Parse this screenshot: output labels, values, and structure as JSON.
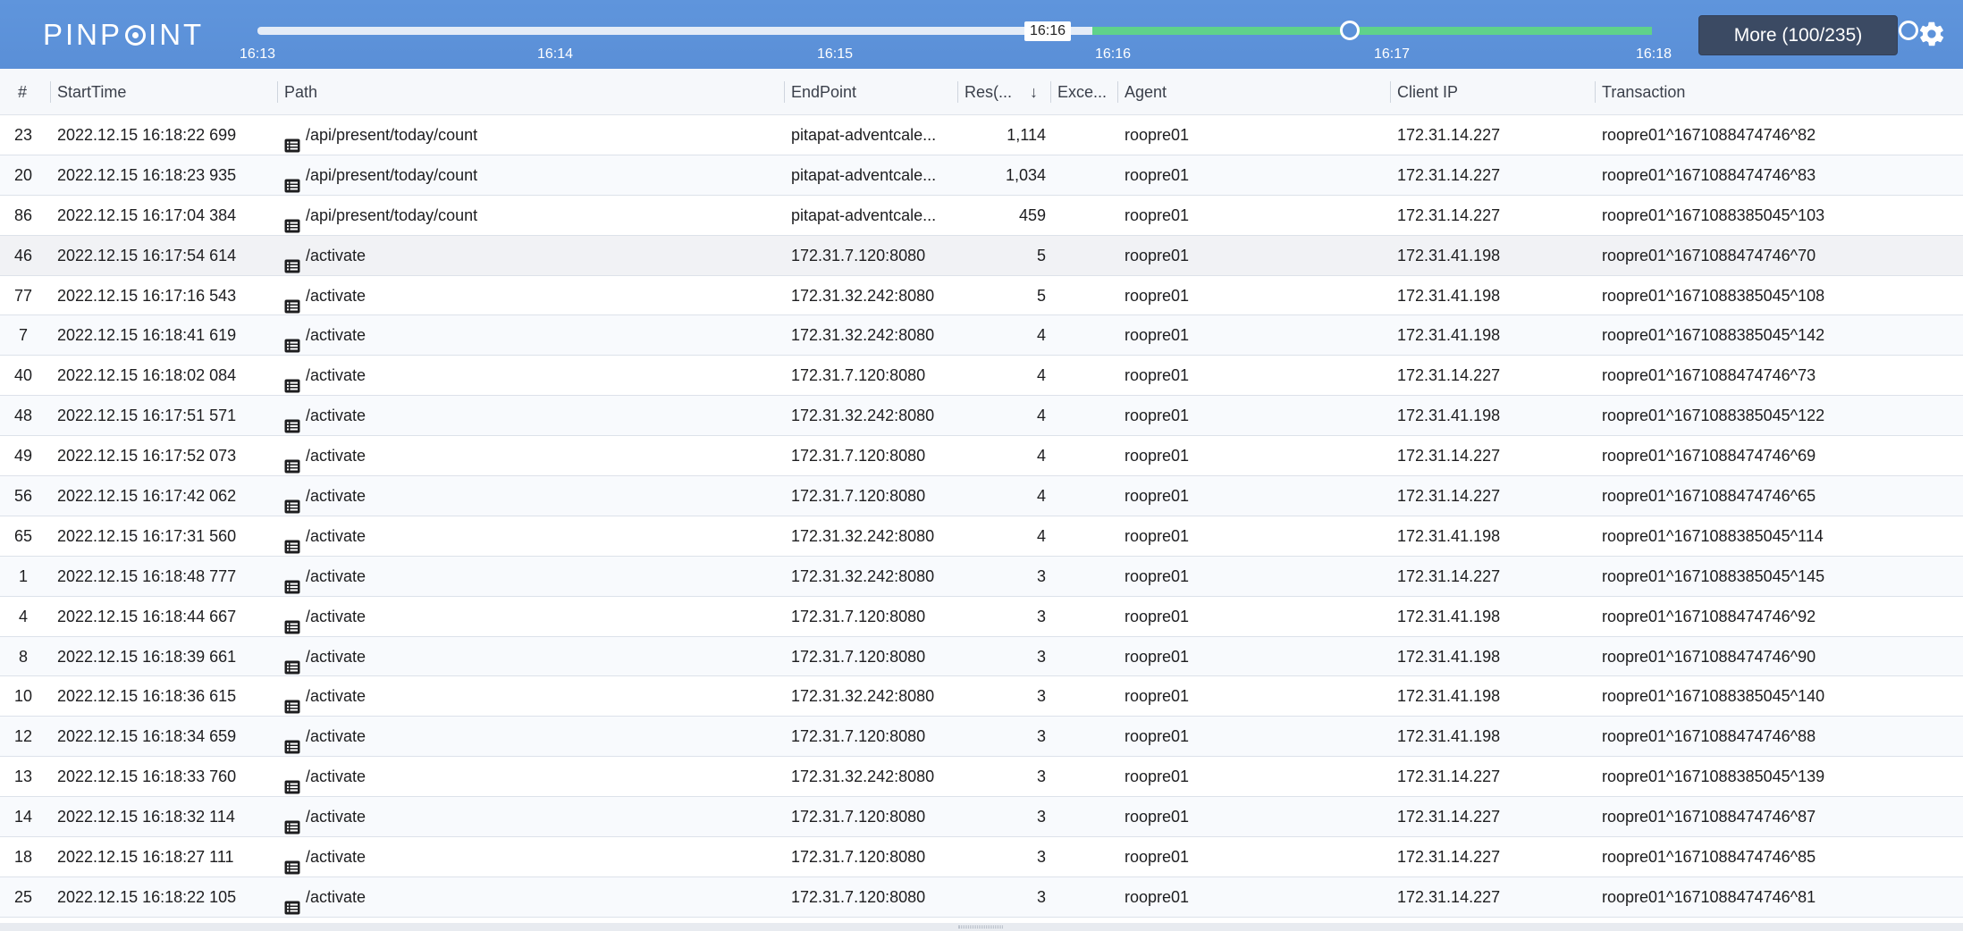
{
  "header": {
    "logo_prefix": "PINP",
    "logo_suffix": "INT",
    "selected_start_label": "16:16",
    "ticks": [
      "16:13",
      "16:14",
      "16:15",
      "16:16",
      "16:17",
      "16:18"
    ],
    "more_button": "More (100/235)",
    "colors": {
      "header_bg": "#5b91d9",
      "selected_range": "#5fd28a",
      "more_button_bg": "#3b4a63"
    }
  },
  "table": {
    "columns": [
      "#",
      "StartTime",
      "Path",
      "EndPoint",
      "Res(...",
      "Exce...",
      "Agent",
      "Client IP",
      "Transaction"
    ],
    "sort_indicator": "↓",
    "rows": [
      {
        "num": "23",
        "start": "2022.12.15 16:18:22 699",
        "path": "/api/present/today/count",
        "endpoint": "pitapat-adventcale...",
        "res": "1,114",
        "exc": "",
        "agent": "roopre01",
        "ip": "172.31.14.227",
        "tx": "roopre01^1671088474746^82"
      },
      {
        "num": "20",
        "start": "2022.12.15 16:18:23 935",
        "path": "/api/present/today/count",
        "endpoint": "pitapat-adventcale...",
        "res": "1,034",
        "exc": "",
        "agent": "roopre01",
        "ip": "172.31.14.227",
        "tx": "roopre01^1671088474746^83"
      },
      {
        "num": "86",
        "start": "2022.12.15 16:17:04 384",
        "path": "/api/present/today/count",
        "endpoint": "pitapat-adventcale...",
        "res": "459",
        "exc": "",
        "agent": "roopre01",
        "ip": "172.31.14.227",
        "tx": "roopre01^1671088385045^103"
      },
      {
        "num": "46",
        "start": "2022.12.15 16:17:54 614",
        "path": "/activate",
        "endpoint": "172.31.7.120:8080",
        "res": "5",
        "exc": "",
        "agent": "roopre01",
        "ip": "172.31.41.198",
        "tx": "roopre01^1671088474746^70"
      },
      {
        "num": "77",
        "start": "2022.12.15 16:17:16 543",
        "path": "/activate",
        "endpoint": "172.31.32.242:8080",
        "res": "5",
        "exc": "",
        "agent": "roopre01",
        "ip": "172.31.41.198",
        "tx": "roopre01^1671088385045^108"
      },
      {
        "num": "7",
        "start": "2022.12.15 16:18:41 619",
        "path": "/activate",
        "endpoint": "172.31.32.242:8080",
        "res": "4",
        "exc": "",
        "agent": "roopre01",
        "ip": "172.31.41.198",
        "tx": "roopre01^1671088385045^142"
      },
      {
        "num": "40",
        "start": "2022.12.15 16:18:02 084",
        "path": "/activate",
        "endpoint": "172.31.7.120:8080",
        "res": "4",
        "exc": "",
        "agent": "roopre01",
        "ip": "172.31.14.227",
        "tx": "roopre01^1671088474746^73"
      },
      {
        "num": "48",
        "start": "2022.12.15 16:17:51 571",
        "path": "/activate",
        "endpoint": "172.31.32.242:8080",
        "res": "4",
        "exc": "",
        "agent": "roopre01",
        "ip": "172.31.41.198",
        "tx": "roopre01^1671088385045^122"
      },
      {
        "num": "49",
        "start": "2022.12.15 16:17:52 073",
        "path": "/activate",
        "endpoint": "172.31.7.120:8080",
        "res": "4",
        "exc": "",
        "agent": "roopre01",
        "ip": "172.31.14.227",
        "tx": "roopre01^1671088474746^69"
      },
      {
        "num": "56",
        "start": "2022.12.15 16:17:42 062",
        "path": "/activate",
        "endpoint": "172.31.7.120:8080",
        "res": "4",
        "exc": "",
        "agent": "roopre01",
        "ip": "172.31.14.227",
        "tx": "roopre01^1671088474746^65"
      },
      {
        "num": "65",
        "start": "2022.12.15 16:17:31 560",
        "path": "/activate",
        "endpoint": "172.31.32.242:8080",
        "res": "4",
        "exc": "",
        "agent": "roopre01",
        "ip": "172.31.41.198",
        "tx": "roopre01^1671088385045^114"
      },
      {
        "num": "1",
        "start": "2022.12.15 16:18:48 777",
        "path": "/activate",
        "endpoint": "172.31.32.242:8080",
        "res": "3",
        "exc": "",
        "agent": "roopre01",
        "ip": "172.31.14.227",
        "tx": "roopre01^1671088385045^145"
      },
      {
        "num": "4",
        "start": "2022.12.15 16:18:44 667",
        "path": "/activate",
        "endpoint": "172.31.7.120:8080",
        "res": "3",
        "exc": "",
        "agent": "roopre01",
        "ip": "172.31.41.198",
        "tx": "roopre01^1671088474746^92"
      },
      {
        "num": "8",
        "start": "2022.12.15 16:18:39 661",
        "path": "/activate",
        "endpoint": "172.31.7.120:8080",
        "res": "3",
        "exc": "",
        "agent": "roopre01",
        "ip": "172.31.41.198",
        "tx": "roopre01^1671088474746^90"
      },
      {
        "num": "10",
        "start": "2022.12.15 16:18:36 615",
        "path": "/activate",
        "endpoint": "172.31.32.242:8080",
        "res": "3",
        "exc": "",
        "agent": "roopre01",
        "ip": "172.31.41.198",
        "tx": "roopre01^1671088385045^140"
      },
      {
        "num": "12",
        "start": "2022.12.15 16:18:34 659",
        "path": "/activate",
        "endpoint": "172.31.7.120:8080",
        "res": "3",
        "exc": "",
        "agent": "roopre01",
        "ip": "172.31.41.198",
        "tx": "roopre01^1671088474746^88"
      },
      {
        "num": "13",
        "start": "2022.12.15 16:18:33 760",
        "path": "/activate",
        "endpoint": "172.31.32.242:8080",
        "res": "3",
        "exc": "",
        "agent": "roopre01",
        "ip": "172.31.14.227",
        "tx": "roopre01^1671088385045^139"
      },
      {
        "num": "14",
        "start": "2022.12.15 16:18:32 114",
        "path": "/activate",
        "endpoint": "172.31.7.120:8080",
        "res": "3",
        "exc": "",
        "agent": "roopre01",
        "ip": "172.31.14.227",
        "tx": "roopre01^1671088474746^87"
      },
      {
        "num": "18",
        "start": "2022.12.15 16:18:27 111",
        "path": "/activate",
        "endpoint": "172.31.7.120:8080",
        "res": "3",
        "exc": "",
        "agent": "roopre01",
        "ip": "172.31.14.227",
        "tx": "roopre01^1671088474746^85"
      },
      {
        "num": "25",
        "start": "2022.12.15 16:18:22 105",
        "path": "/activate",
        "endpoint": "172.31.7.120:8080",
        "res": "3",
        "exc": "",
        "agent": "roopre01",
        "ip": "172.31.14.227",
        "tx": "roopre01^1671088474746^81"
      }
    ]
  }
}
